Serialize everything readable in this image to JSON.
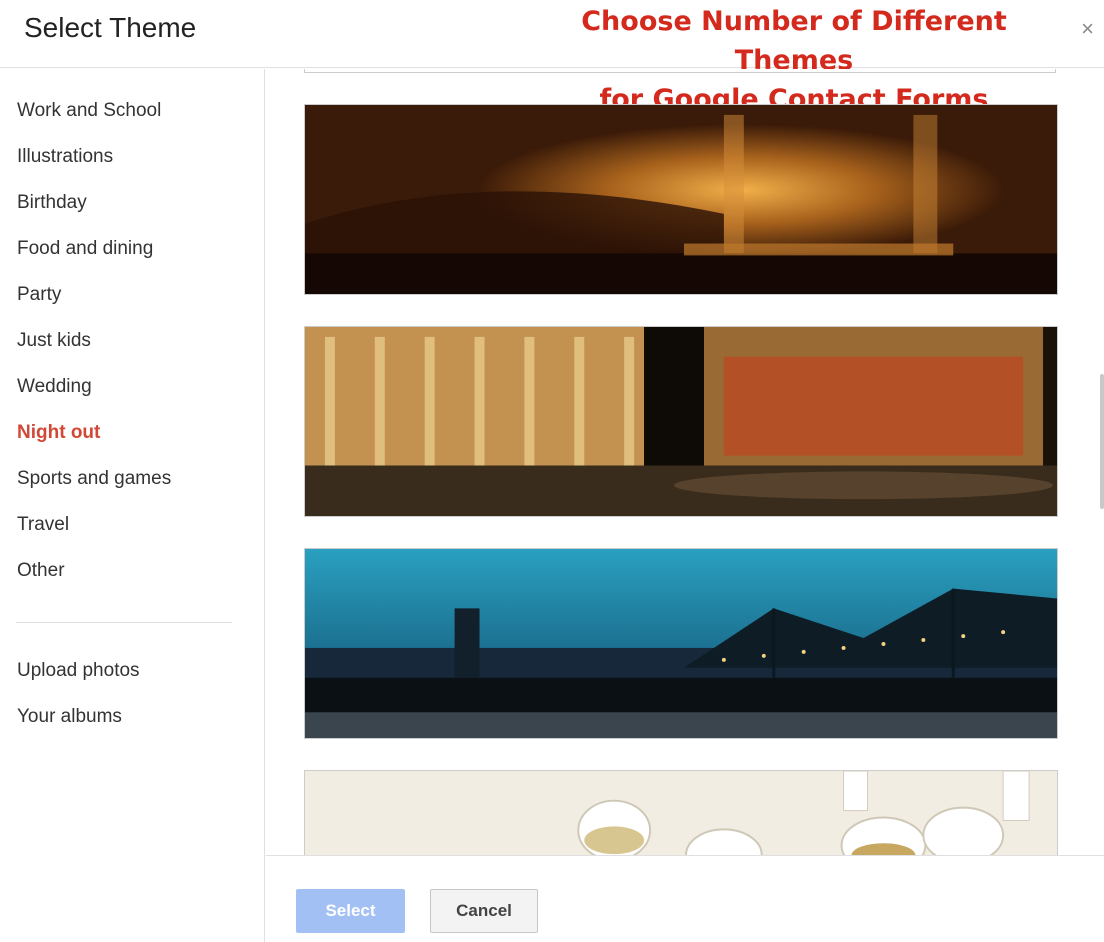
{
  "dialog": {
    "title": "Select Theme",
    "annotation_line1": "Choose Number of Different Themes",
    "annotation_line2": "for Google Contact Forms",
    "close_label": "×"
  },
  "sidebar": {
    "categories": [
      {
        "label": "Work and School"
      },
      {
        "label": "Illustrations"
      },
      {
        "label": "Birthday"
      },
      {
        "label": "Food and dining"
      },
      {
        "label": "Party"
      },
      {
        "label": "Just kids"
      },
      {
        "label": "Wedding"
      },
      {
        "label": "Night out",
        "active": true
      },
      {
        "label": "Sports and games"
      },
      {
        "label": "Travel"
      },
      {
        "label": "Other"
      }
    ],
    "extras": [
      {
        "label": "Upload photos"
      },
      {
        "label": "Your albums"
      }
    ]
  },
  "themes": [
    {
      "name": "theater-interior"
    },
    {
      "name": "lincoln-center-plaza"
    },
    {
      "name": "bridge-at-dusk"
    },
    {
      "name": "champagne-glasses"
    }
  ],
  "footer": {
    "select_label": "Select",
    "cancel_label": "Cancel"
  },
  "colors": {
    "active_category": "#d14836",
    "annotation": "#d42a1e",
    "select_button": "#a3c0f5"
  }
}
